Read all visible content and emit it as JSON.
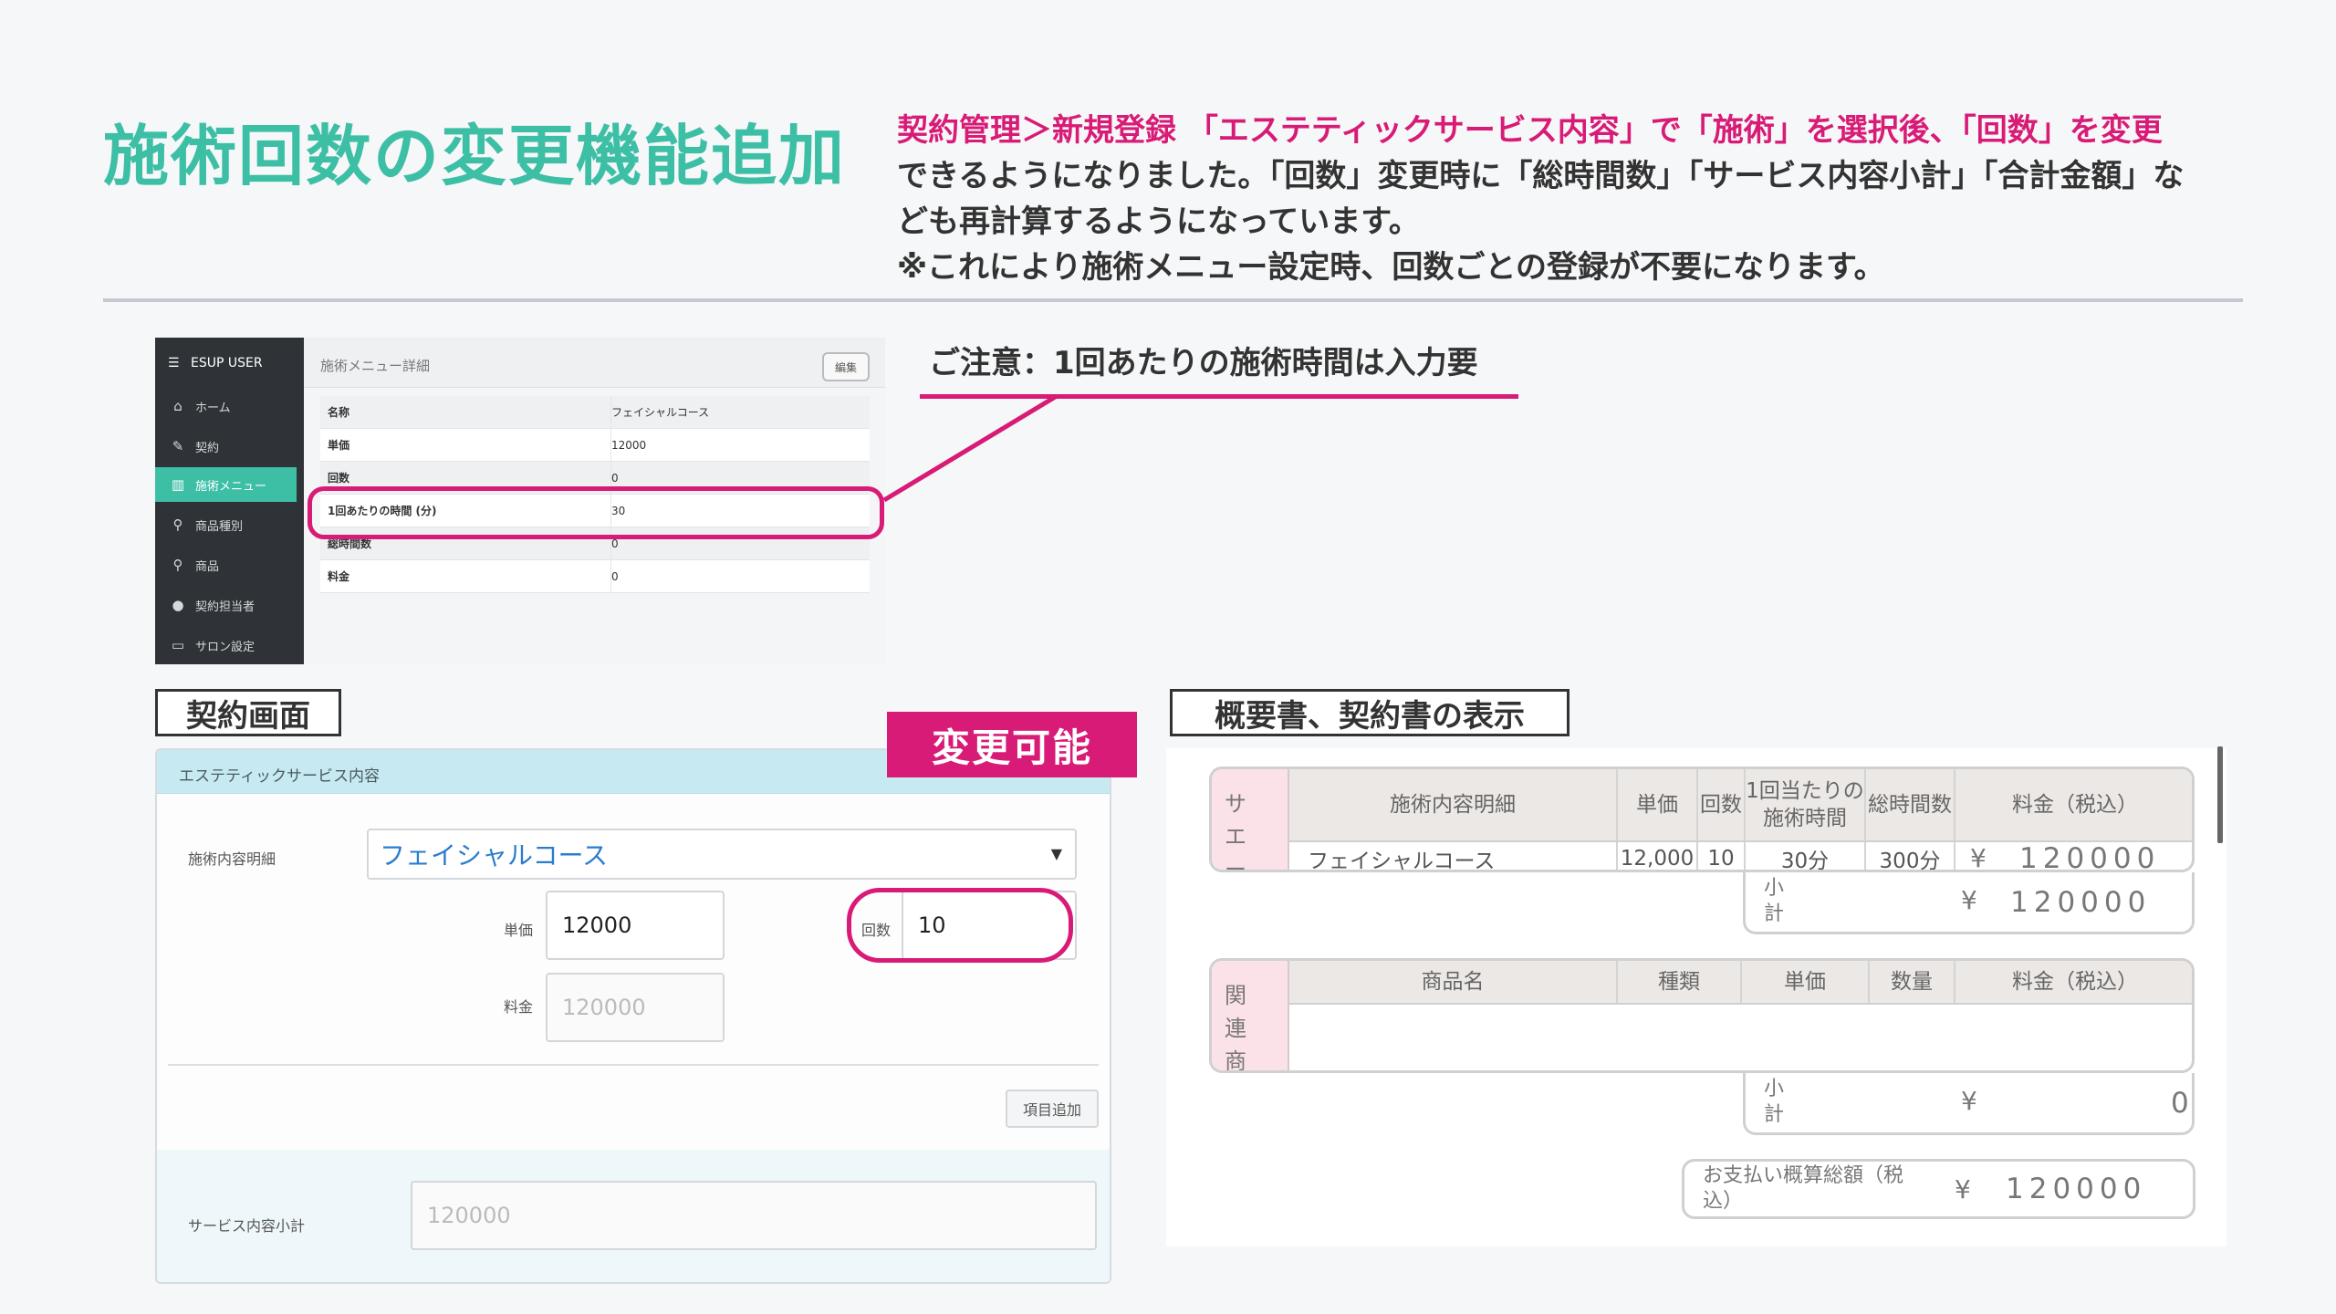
{
  "page": {
    "title": "施術回数の変更機能追加",
    "desc_line1_accent": "契約管理＞新規登録 「エステティックサービス内容」で「施術」を選択後、「回数」を変更",
    "desc_line2": "できるようになりました。「回数」変更時に「総時間数」「サービス内容小計」「合計金額」な",
    "desc_line3": "ども再計算するようになっています。",
    "desc_line4": "※これにより施術メニュー設定時、回数ごとの登録が不要になります。"
  },
  "note": {
    "text": "ご注意：1回あたりの施術時間は入力要"
  },
  "admin": {
    "brand": "ESUP USER",
    "nav": [
      {
        "label": "ホーム",
        "icon": "home-icon"
      },
      {
        "label": "契約",
        "icon": "contract-icon"
      },
      {
        "label": "施術メニュー",
        "icon": "treatment-icon"
      },
      {
        "label": "商品種別",
        "icon": "category-icon"
      },
      {
        "label": "商品",
        "icon": "product-icon"
      },
      {
        "label": "契約担当者",
        "icon": "person-icon"
      },
      {
        "label": "サロン設定",
        "icon": "store-icon"
      }
    ],
    "header_title": "施術メニュー詳細",
    "edit_label": "編集",
    "rows": [
      {
        "key": "名称",
        "value": "フェイシャルコース"
      },
      {
        "key": "単価",
        "value": "12000"
      },
      {
        "key": "回数",
        "value": "0"
      },
      {
        "key": "1回あたりの時間 (分)",
        "value": "30"
      },
      {
        "key": "総時間数",
        "value": "0"
      },
      {
        "key": "料金",
        "value": "0"
      }
    ]
  },
  "contract": {
    "section_label": "契約画面",
    "header": "エステティックサービス内容",
    "detail_label": "施術内容明細",
    "detail_value": "フェイシャルコース",
    "unit_label": "単価",
    "unit_value": "12000",
    "count_label": "回数",
    "count_value": "10",
    "price_label": "料金",
    "price_value": "120000",
    "add_label": "項目追加",
    "subtotal_label": "サービス内容小計",
    "subtotal_value": "120000",
    "change_label": "変更可能"
  },
  "overview": {
    "section_label": "概要書、契約書の表示",
    "service_side": "サエース",
    "service_headers": [
      "施術内容明細",
      "単価",
      "回数",
      "1回当たりの施術時間",
      "総時間数",
      "料金（税込）"
    ],
    "service_row": [
      "フェイシャルコース",
      "12,000",
      "10",
      "30分",
      "300分"
    ],
    "yen": "¥",
    "amount_digits": "120000",
    "subtotal_label": "小計",
    "product_side": "関連商",
    "product_headers": [
      "商品名",
      "種類",
      "単価",
      "数量",
      "料金（税込）"
    ],
    "product_subtotal_digit": "0",
    "total_label": "お支払い概算総額（税込）"
  }
}
